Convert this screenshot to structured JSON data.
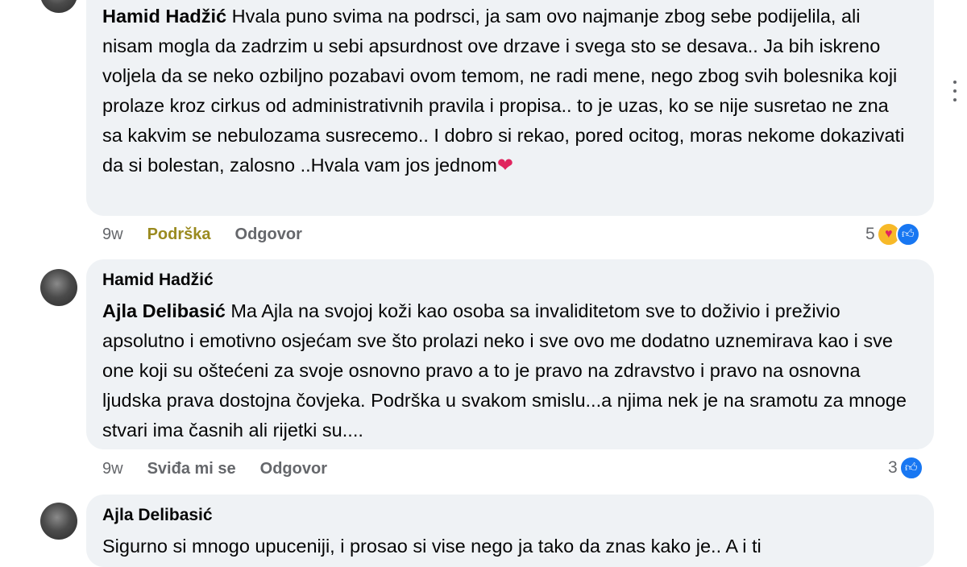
{
  "comment1": {
    "author": "Hamid Hadžić",
    "text": "Hvala puno svima na podrsci, ja sam ovo najmanje zbog sebe podijelila, ali nisam mogla da zadrzim u sebi apsurdnost ove drzave i svega sto se desava.. Ja bih iskreno voljela da se neko ozbiljno pozabavi ovom temom, ne radi mene, nego zbog svih bolesnika koji prolaze kroz cirkus od administrativnih pravila i propisa.. to je uzas, ko se nije susretao ne zna sa kakvim se nebulozama susrecemo.. I dobro si rekao, pored ocitog, moras nekome dokazivati da si bolestan, zalosno ..Hvala vam jos jednom",
    "emoji": "❤",
    "time": "9w",
    "reaction_action": "Podrška",
    "reply_label": "Odgovor",
    "reaction_count": "5"
  },
  "comment2": {
    "author": "Hamid Hadžić",
    "mention": "Ajla Delibasić",
    "text": "Ma Ajla na svojoj koži kao osoba sa invaliditetom sve to doživio i preživio apsolutno i emotivno osjećam sve što prolazi neko i sve ovo me dodatno uznemirava kao i sve one koji su oštećeni za svoje osnovno pravo a to je pravo na zdravstvo i pravo na osnovna ljudska prava dostojna čovjeka. Podrška u svakom smislu...a njima nek je na sramotu za mnoge stvari ima časnih ali rijetki su....",
    "time": "9w",
    "like_label": "Sviđa mi se",
    "reply_label": "Odgovor",
    "reaction_count": "3"
  },
  "comment3": {
    "author": "Ajla Delibasić",
    "text": "Sigurno si mnogo upuceniji, i prosao si vise nego ja tako da znas kako je.. A i ti"
  },
  "icons": {
    "care": "care-reaction-icon",
    "like": "like-reaction-icon",
    "more": "more-options-icon"
  },
  "colors": {
    "bubble": "#eff2f5",
    "support": "#9a8a1f",
    "like_blue": "#1877f2"
  }
}
